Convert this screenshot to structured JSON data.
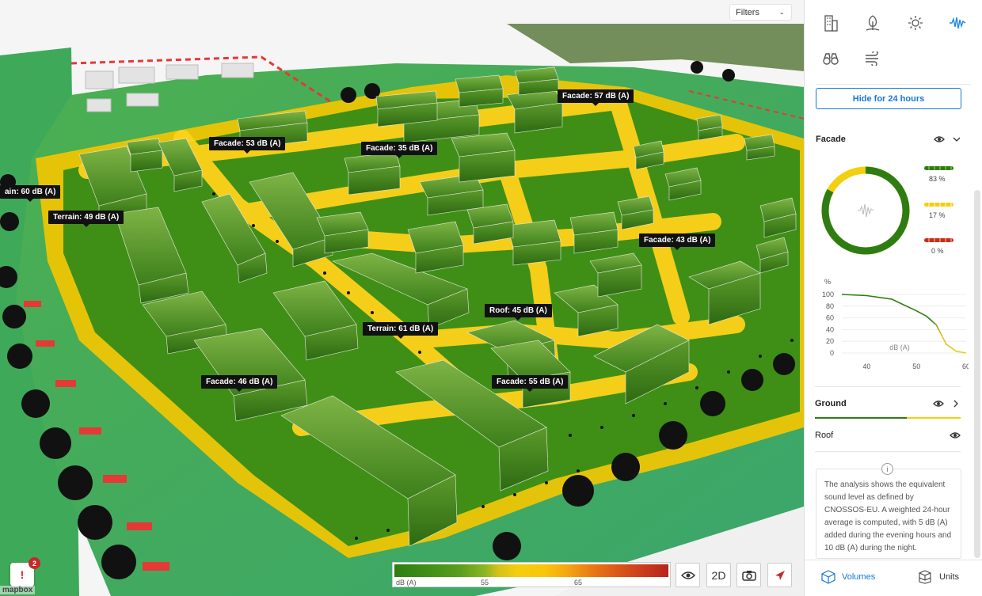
{
  "map": {
    "filters_label": "Filters",
    "attribution": "mapbox",
    "labels": [
      {
        "text": "Facade: 57 dB (A)"
      },
      {
        "text": "Facade: 53 dB (A)"
      },
      {
        "text": "Facade: 35 dB (A)"
      },
      {
        "text": "ain: 60 dB (A)"
      },
      {
        "text": "Terrain: 49 dB (A)"
      },
      {
        "text": "Facade: 43 dB (A)"
      },
      {
        "text": "Roof: 45 dB (A)"
      },
      {
        "text": "Terrain: 61 dB (A)"
      },
      {
        "text": "Facade: 46 dB (A)"
      },
      {
        "text": "Facade: 55 dB (A)"
      }
    ],
    "legend": {
      "unit": "dB (A)",
      "tick1": "55",
      "tick2": "65"
    },
    "buttons": {
      "view": "👁",
      "mode": "2D",
      "camera": "📷",
      "compass": "➤"
    },
    "notifications": {
      "icon": "!",
      "count": "2"
    }
  },
  "panel": {
    "tools": [
      "building-icon",
      "tree-icon",
      "sun-icon",
      "sound-wave-icon",
      "binoculars-icon",
      "wind-icon"
    ],
    "hide_button": "Hide for 24 hours",
    "facade": {
      "title": "Facade",
      "shares": [
        {
          "pct": "83 %",
          "color": "#2e7d12"
        },
        {
          "pct": "17 %",
          "color": "#f4cf0e"
        },
        {
          "pct": "0 %",
          "color": "#c0311a"
        }
      ]
    },
    "curve": {
      "y_unit": "%",
      "y_ticks": [
        "100",
        "80",
        "60",
        "40",
        "20",
        "0"
      ],
      "x_ticks": [
        "40",
        "50",
        "60"
      ],
      "x_label": "dB (A)"
    },
    "ground_title": "Ground",
    "roof_title": "Roof",
    "info_text": "The analysis shows the equivalent sound level as defined by CNOSSOS-EU. A weighted 24-hour average is computed, with 5 dB (A) added during the evening hours and 10 dB (A) during the night.",
    "footer": {
      "volumes": "Volumes",
      "units": "Units"
    }
  },
  "chart_data": {
    "type": "line",
    "series": [
      {
        "values": [
          [
            35,
            100
          ],
          [
            40,
            98
          ],
          [
            45,
            92
          ],
          [
            50,
            72
          ],
          [
            52,
            63
          ],
          [
            54,
            48
          ],
          [
            56,
            15
          ],
          [
            58,
            3
          ],
          [
            60,
            0
          ]
        ]
      }
    ],
    "xlabel": "dB (A)",
    "ylabel": "%",
    "xlim": [
      35,
      60
    ],
    "ylim": [
      0,
      100
    ],
    "grid": true
  }
}
